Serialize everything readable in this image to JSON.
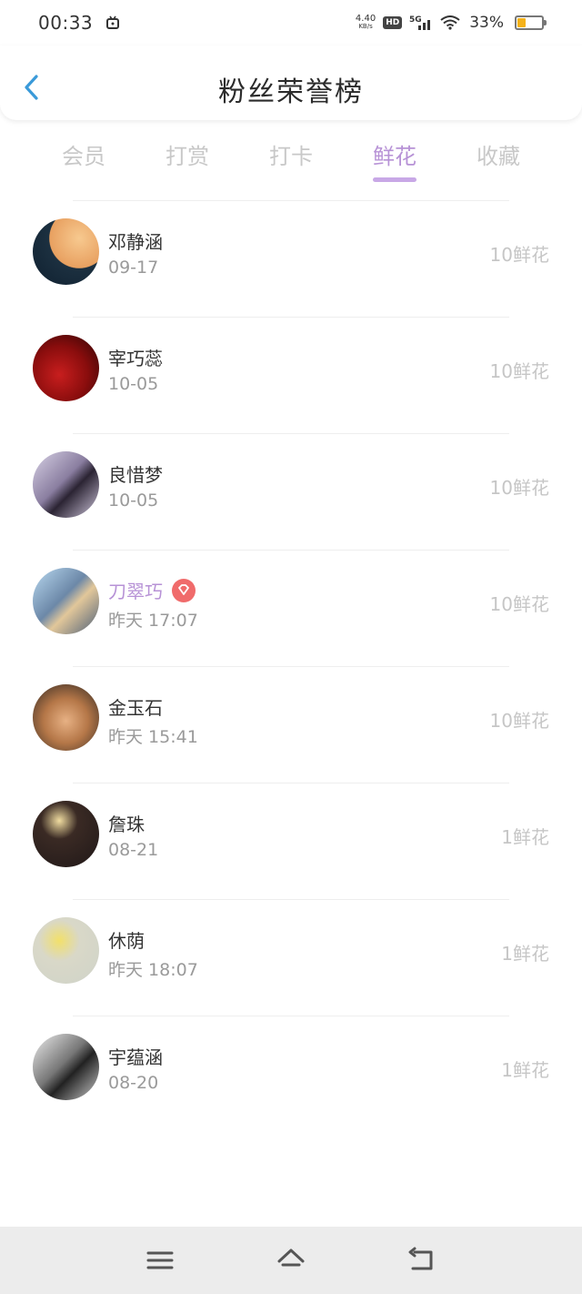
{
  "status_bar": {
    "time": "00:33",
    "net_speed": "4.40",
    "net_unit": "KB/s",
    "hd": "HD",
    "network": "5G",
    "battery": "33%",
    "battery_level": 0.33
  },
  "header": {
    "title": "粉丝荣誉榜"
  },
  "tabs": [
    {
      "label": "会员",
      "active": false
    },
    {
      "label": "打赏",
      "active": false
    },
    {
      "label": "打卡",
      "active": false
    },
    {
      "label": "鲜花",
      "active": true
    },
    {
      "label": "收藏",
      "active": false
    }
  ],
  "fans": [
    {
      "name": "邓静涵",
      "date": "09-17",
      "value": "10鲜花"
    },
    {
      "name": "宰巧蕊",
      "date": "10-05",
      "value": "10鲜花"
    },
    {
      "name": "良惜梦",
      "date": "10-05",
      "value": "10鲜花"
    },
    {
      "name": "刀翠巧",
      "date": "昨天 17:07",
      "value": "10鲜花",
      "vip": true
    },
    {
      "name": "金玉石",
      "date": "昨天 15:41",
      "value": "10鲜花"
    },
    {
      "name": "詹珠",
      "date": "08-21",
      "value": "1鲜花"
    },
    {
      "name": "休荫",
      "date": "昨天 18:07",
      "value": "1鲜花"
    },
    {
      "name": "宇蕴涵",
      "date": "08-20",
      "value": "1鲜花"
    }
  ],
  "colors": {
    "accent": "#b792d6",
    "vip_badge": "#f06b6b",
    "back_arrow": "#3a9ad9"
  }
}
